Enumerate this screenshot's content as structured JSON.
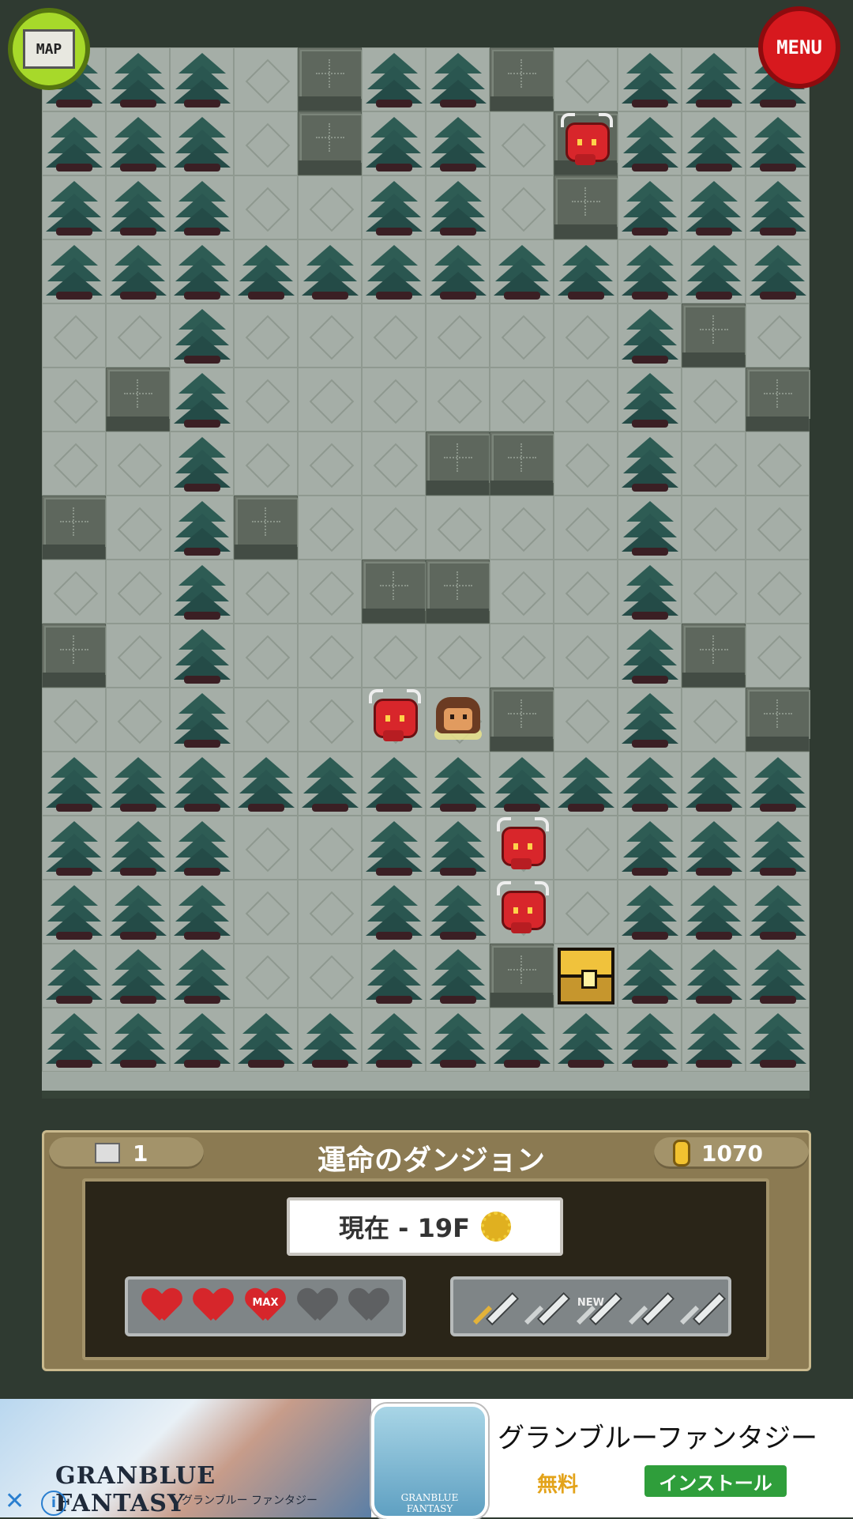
{
  "buttons": {
    "map_label": "MAP",
    "menu_label": "MENU"
  },
  "map": {
    "rows": [
      "TTTFBTTBFTTT",
      "TTTFBTTFBTTT",
      "TTTFFTTFBTTT",
      "TTTTTTTTTTTT",
      "FFTFFFFFFTBF",
      "FBTFFFFFFTFB",
      "FFTFFFBBFTFF",
      "BFTBFFFFFTFF",
      "FFTFFBBFFTFF",
      "BFTFFFFFFTBF",
      "FFTFFFFBFTFB",
      "TTTTTTTTTTTT",
      "TTTFFTTFFTTT",
      "TTTFFTTFFTTT",
      "TTTFFTTBCTTT",
      "TTTTTTTTTTTT"
    ],
    "legend": {
      "T": "tree",
      "F": "floor",
      "B": "stone-block",
      "C": "treasure-chest"
    }
  },
  "entities": [
    {
      "type": "demon",
      "col": 8,
      "row": 1
    },
    {
      "type": "demon",
      "col": 5,
      "row": 10
    },
    {
      "type": "hero",
      "col": 6,
      "row": 10
    },
    {
      "type": "demon",
      "col": 7,
      "row": 12
    },
    {
      "type": "demon",
      "col": 7,
      "row": 13
    }
  ],
  "status": {
    "scroll_count": "1",
    "dungeon_name": "運命のダンジョン",
    "coins": "1070",
    "floor_label": "現在 - 19F",
    "hearts": [
      {
        "state": "full",
        "label": ""
      },
      {
        "state": "full",
        "label": ""
      },
      {
        "state": "full",
        "label": "MAX"
      },
      {
        "state": "empty",
        "label": ""
      },
      {
        "state": "empty",
        "label": ""
      }
    ],
    "swords": [
      {
        "state": "equipped",
        "label": ""
      },
      {
        "state": "normal",
        "label": ""
      },
      {
        "state": "normal",
        "label": "NEW"
      },
      {
        "state": "normal",
        "label": ""
      },
      {
        "state": "normal",
        "label": ""
      }
    ],
    "colors": {
      "heart_full": "#d6262b",
      "heart_empty": "#5e6062",
      "hilt_gold": "#e3b23a",
      "hilt_plain": "#cfd3d3"
    }
  },
  "ad": {
    "logo": "GRANBLUE FANTASY",
    "logo_sub": "グランブルー ファンタジー",
    "title": "グランブルーファンタジー",
    "price": "無料",
    "install": "インストール",
    "icon_caption": "GRANBLUE FANTASY",
    "close": "✕",
    "info": "i"
  }
}
